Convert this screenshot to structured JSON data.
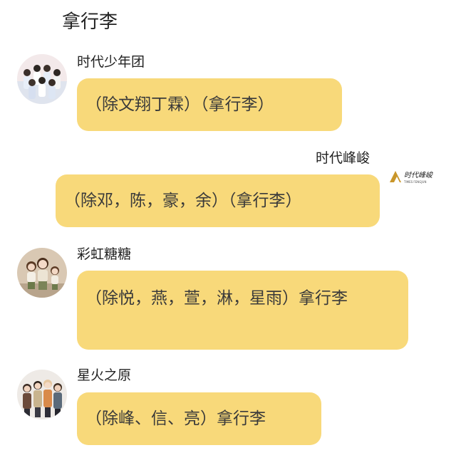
{
  "page": {
    "title": "拿行李"
  },
  "messages": [
    {
      "sender": "时代少年团",
      "text": "（除文翔丁霖）（拿行李）",
      "avatar_icon": "group-photo-avatar-icon"
    },
    {
      "sender": "时代峰峻",
      "text": "（除邓，陈，豪，余）（拿行李）",
      "logo_text": "时代峰峻",
      "logo_subtext": "TIMES FENGJUN"
    },
    {
      "sender": "彩虹糖糖",
      "text": "（除悦，燕，萱，淋，星雨）拿行李",
      "avatar_icon": "cartoon-girls-avatar-icon"
    },
    {
      "sender": "星火之原",
      "text": "（除峰、信、亮）拿行李",
      "avatar_icon": "cartoon-boys-avatar-icon"
    }
  ],
  "colors": {
    "bubble": "#f8d97a",
    "logo_gold": "#c9962a"
  }
}
